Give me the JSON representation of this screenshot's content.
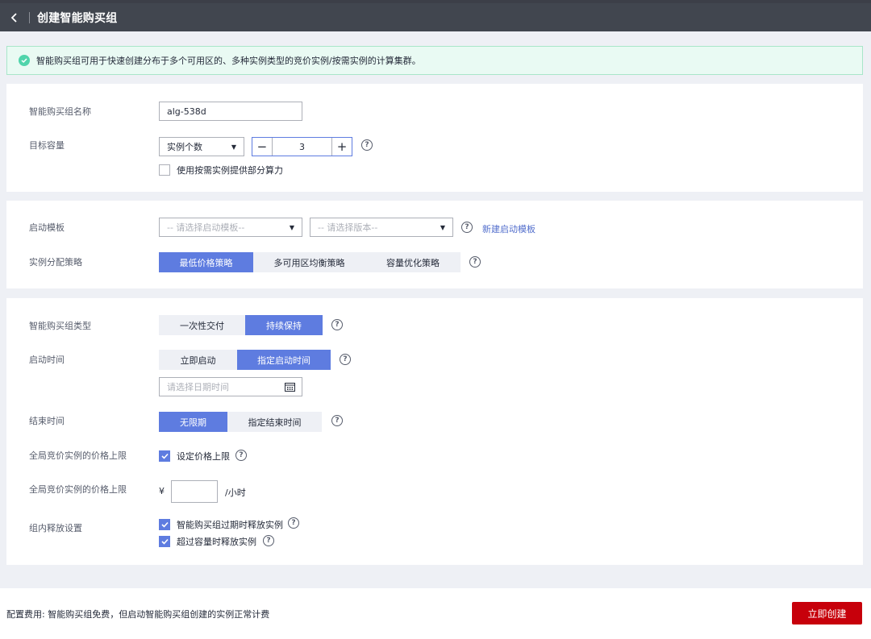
{
  "header": {
    "back_icon": "chevron-left-icon",
    "title": "创建智能购买组"
  },
  "notice": {
    "icon": "check-circle-icon",
    "text": "智能购买组可用于快速创建分布于多个可用区的、多种实例类型的竞价实例/按需实例的计算集群。"
  },
  "basic": {
    "name_label": "智能购买组名称",
    "name_value": "alg-538d",
    "capacity_label": "目标容量",
    "capacity_type": "实例个数",
    "capacity_value": "3",
    "ondemand_label": "使用按需实例提供部分算力",
    "ondemand_checked": false
  },
  "template": {
    "label": "启动模板",
    "template_placeholder": "-- 请选择启动模板--",
    "version_placeholder": "-- 请选择版本--",
    "new_link": "新建启动模板",
    "strategy_label": "实例分配策略",
    "strategies": [
      "最低价格策略",
      "多可用区均衡策略",
      "容量优化策略"
    ],
    "strategy_selected": 0
  },
  "schedule": {
    "type_label": "智能购买组类型",
    "types": [
      "一次性交付",
      "持续保持"
    ],
    "type_selected": 1,
    "start_label": "启动时间",
    "starts": [
      "立即启动",
      "指定启动时间"
    ],
    "start_selected": 1,
    "date_placeholder": "请选择日期时间",
    "calendar_icon": "calendar-icon",
    "end_label": "结束时间",
    "ends": [
      "无限期",
      "指定结束时间"
    ],
    "end_selected": 0,
    "price_limit_label": "全局竞价实例的价格上限",
    "price_limit_check": "设定价格上限",
    "price_limit_checked": true,
    "price_label": "全局竞价实例的价格上限",
    "currency": "¥",
    "price_value": "",
    "price_unit": "/小时",
    "release_label": "组内释放设置",
    "release_expire": "智能购买组过期时释放实例",
    "release_expire_checked": true,
    "release_over": "超过容量时释放实例",
    "release_over_checked": true
  },
  "footer": {
    "fee_text": "配置费用: 智能购买组免费，但启动智能购买组创建的实例正常计费",
    "create_label": "立即创建"
  },
  "colors": {
    "primary": "#5e7ce0",
    "danger": "#c7000b",
    "success": "#50d4ab",
    "header": "#41464f"
  }
}
